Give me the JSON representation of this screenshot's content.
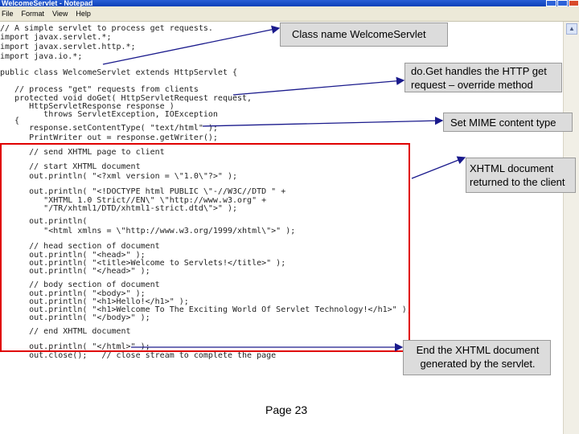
{
  "window": {
    "title": "WelcomeServlet - Notepad",
    "menu": [
      "File",
      "Format",
      "View",
      "Help"
    ]
  },
  "code_lines": [
    "// A simple servlet to process get requests.",
    "",
    "import javax.servlet.*;",
    "import javax.servlet.http.*;",
    "import java.io.*;",
    "",
    "public class WelcomeServlet extends HttpServlet {",
    "",
    "   // process \"get\" requests from clients",
    "   protected void doGet( HttpServletRequest request,",
    "      HttpServletResponse response )",
    "         throws ServletException, IOException",
    "   {",
    "      response.setContentType( \"text/html\" );",
    "      PrintWriter out = response.getWriter();",
    "",
    "      // send XHTML page to client",
    "",
    "      // start XHTML document",
    "      out.println( \"<?xml version = \\\"1.0\\\"?>\" );",
    "",
    "      out.println( \"<!DOCTYPE html PUBLIC \\\"-//W3C//DTD \" +",
    "         \"XHTML 1.0 Strict//EN\\\" \\\"http://www.w3.org\" +",
    "         \"/TR/xhtml1/DTD/xhtml1-strict.dtd\\\">\" );",
    "",
    "      out.println(",
    "         \"<html xmlns = \\\"http://www.w3.org/1999/xhtml\\\">\" );",
    "",
    "      // head section of document",
    "      out.println( \"<head>\" );",
    "      out.println( \"<title>Welcome to Servlets!</title>\" );",
    "      out.println( \"</head>\" );",
    "",
    "      // body section of document",
    "      out.println( \"<body>\" );",
    "      out.println( \"<h1>Hello!</h1>\" );",
    "      out.println( \"<h1>Welcome To The Exciting World Of Servlet Technology!</h1>\" );",
    "      out.println( \"</body>\" );",
    "",
    "      // end XHTML document",
    "      out.println( \"</html>\" );",
    "      out.close();   // close stream to complete the page"
  ],
  "callouts": {
    "class_name": "Class name WelcomeServlet",
    "doget": "do.Get handles the HTTP get request – override method",
    "mime": "Set MIME content type",
    "xhtml": "XHTML document returned to the client",
    "end": "End the XHTML document generated by the servlet."
  },
  "page_label": "Page 23"
}
